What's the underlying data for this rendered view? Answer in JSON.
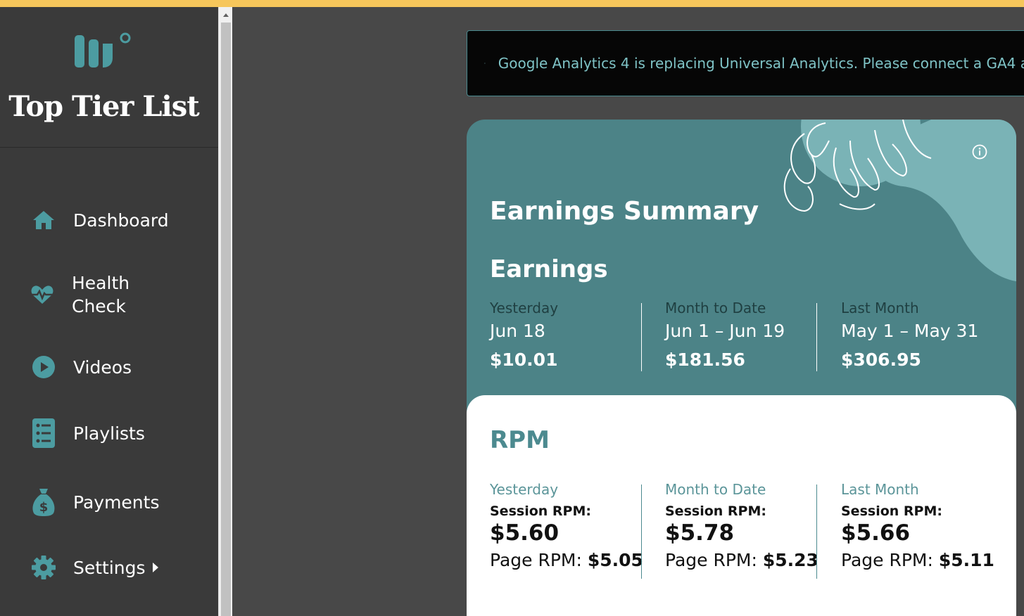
{
  "brand": {
    "title": "Top Tier List"
  },
  "sidebar": {
    "items": [
      {
        "label": "Dashboard",
        "icon": "home-icon"
      },
      {
        "label": "Health",
        "label2": "Check",
        "icon": "heartbeat-icon"
      },
      {
        "label": "Videos",
        "icon": "play-circle-icon"
      },
      {
        "label": "Playlists",
        "icon": "list-icon"
      },
      {
        "label": "Payments",
        "icon": "money-bag-icon"
      },
      {
        "label": "Settings",
        "icon": "gear-icon"
      }
    ]
  },
  "notice": {
    "text": "Google Analytics 4 is replacing Universal Analytics. Please connect a GA4 a"
  },
  "earnings": {
    "title": "Earnings Summary",
    "subtitle": "Earnings",
    "columns": [
      {
        "label": "Yesterday",
        "date": "Jun 18",
        "amount": "$10.01"
      },
      {
        "label": "Month to Date",
        "date": "Jun 1 – Jun 19",
        "amount": "$181.56"
      },
      {
        "label": "Last Month",
        "date": "May 1 – May 31",
        "amount": "$306.95"
      }
    ]
  },
  "rpm": {
    "title": "RPM",
    "columns": [
      {
        "label": "Yesterday",
        "session_label": "Session RPM:",
        "session_value": "$5.60",
        "page_label": "Page RPM:",
        "page_value": "$5.05"
      },
      {
        "label": "Month to Date",
        "session_label": "Session RPM:",
        "session_value": "$5.78",
        "page_label": "Page RPM:",
        "page_value": "$5.23"
      },
      {
        "label": "Last Month",
        "session_label": "Session RPM:",
        "session_value": "$5.66",
        "page_label": "Page RPM:",
        "page_value": "$5.11"
      }
    ]
  },
  "colors": {
    "accent": "#4c8387",
    "topbar": "#f6c65b",
    "sidebar": "#3a3a3a"
  }
}
